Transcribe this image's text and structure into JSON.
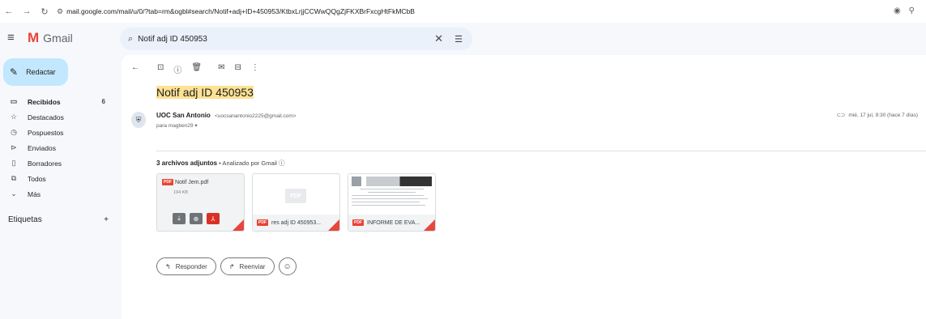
{
  "browser": {
    "url": "mail.google.com/mail/u/0/?tab=rm&ogbl#search/Notif+adj+ID+450953/KtbxLrjjCCWwQQgZjFKXBrFxcgHtFkMCbB"
  },
  "app": {
    "name": "Gmail"
  },
  "search": {
    "value": "Notif adj ID 450953"
  },
  "sidebar": {
    "compose_label": "Redactar",
    "items": [
      {
        "label": "Recibidos",
        "count": "6",
        "icon": "inbox-icon"
      },
      {
        "label": "Destacados",
        "icon": "star-icon"
      },
      {
        "label": "Pospuestos",
        "icon": "clock-icon"
      },
      {
        "label": "Enviados",
        "icon": "send-icon"
      },
      {
        "label": "Borradores",
        "icon": "draft-icon"
      },
      {
        "label": "Todos",
        "icon": "all-mail-icon"
      },
      {
        "label": "Más",
        "icon": "chevron-down-icon"
      }
    ],
    "labels_heading": "Etiquetas"
  },
  "email": {
    "subject_prefix": "Notif ",
    "subject_word_adj": "adj",
    "subject_mid": " ID ",
    "subject_id": "450953",
    "sender_name": "UOC San Antonio",
    "sender_email": "<uocsanantonio2225@gmail.com>",
    "recipient": "para magben29",
    "date": "mié, 17 jul, 9:30 (hace 7 días)"
  },
  "attachments": {
    "count_text": "3 archivos adjuntos",
    "scan_text": "• Analizado por Gmail",
    "items": [
      {
        "name": "Notif Jem.pdf",
        "size": "194 KB"
      },
      {
        "name": "res adj ID 450953..."
      },
      {
        "name": "INFORME DE EVA..."
      }
    ],
    "pdf_badge": "PDF"
  },
  "actions": {
    "reply": "Responder",
    "forward": "Reenviar"
  }
}
